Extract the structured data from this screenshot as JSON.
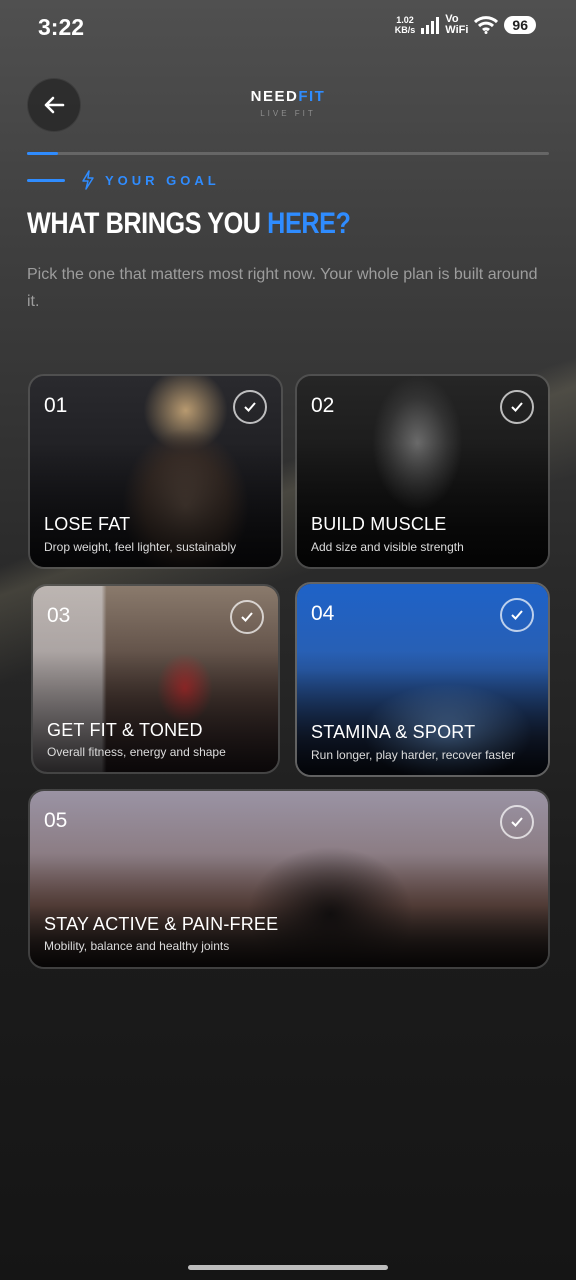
{
  "status_bar": {
    "time": "3:22",
    "net_speed_value": "1.02",
    "net_speed_unit": "KB/s",
    "vo_label": "Vo",
    "wifi_label": "WiFi",
    "battery": "96"
  },
  "header": {
    "logo_part1": "NEED",
    "logo_part2": "FIT",
    "logo_tagline": "LIVE FIT",
    "back_icon": "arrow-left-icon",
    "progress": 0.06
  },
  "section": {
    "label": "YOUR GOAL",
    "label_icon": "lightning-icon",
    "heading_part1": "WHAT BRINGS YOU ",
    "heading_part2": "HERE?",
    "description": "Pick the one that matters most right now. Your whole plan is built around it."
  },
  "options": [
    {
      "number": "01",
      "title": "LOSE FAT",
      "subtitle": "Drop weight, feel lighter, sustainably"
    },
    {
      "number": "02",
      "title": "BUILD MUSCLE",
      "subtitle": "Add size and visible strength"
    },
    {
      "number": "03",
      "title": "GET FIT & TONED",
      "subtitle": "Overall fitness, energy and shape"
    },
    {
      "number": "04",
      "title": "STAMINA & SPORT",
      "subtitle": "Run longer, play harder, recover faster"
    },
    {
      "number": "05",
      "title": "STAY ACTIVE & PAIN-FREE",
      "subtitle": "Mobility, balance and healthy joints"
    }
  ],
  "colors": {
    "accent": "#2f8cff",
    "background": "#1b1b1b"
  }
}
